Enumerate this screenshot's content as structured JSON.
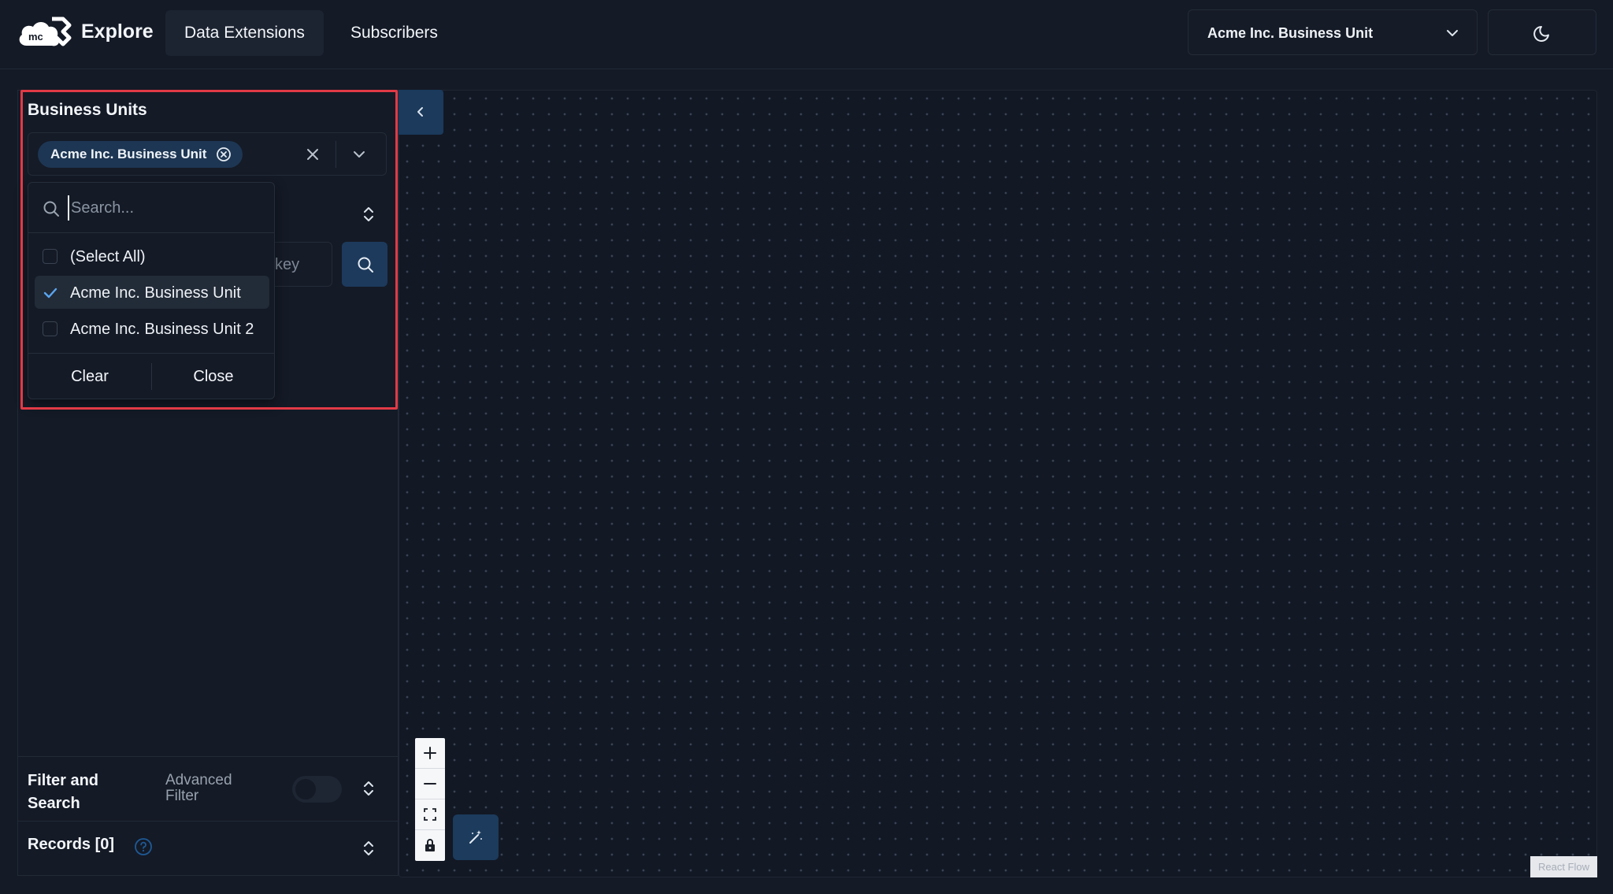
{
  "header": {
    "logo_text": "mc",
    "brand": "Explore",
    "nav": [
      {
        "label": "Data Extensions",
        "active": true
      },
      {
        "label": "Subscribers",
        "active": false
      }
    ],
    "business_unit_select": "Acme Inc. Business Unit",
    "theme_icon": "moon-icon"
  },
  "sidebar": {
    "business_units_title": "Business Units",
    "selected_chip": "Acme Inc. Business Unit",
    "dropdown": {
      "search_placeholder": "Search...",
      "options": [
        {
          "label": "(Select All)",
          "checked": false
        },
        {
          "label": "Acme Inc. Business Unit",
          "checked": true
        },
        {
          "label": "Acme Inc. Business Unit 2",
          "checked": false
        }
      ],
      "clear_label": "Clear",
      "close_label": "Close"
    },
    "obscured_input_text": "key",
    "filter_and_search_title": "Filter and Search",
    "advanced_filter_label": "Advanced Filter",
    "advanced_filter_on": false,
    "records_title": "Records [0]"
  },
  "canvas": {
    "attribution": "React Flow"
  },
  "colors": {
    "background": "#141a26",
    "accent": "#1d3a5c",
    "highlight": "#e23a46"
  }
}
